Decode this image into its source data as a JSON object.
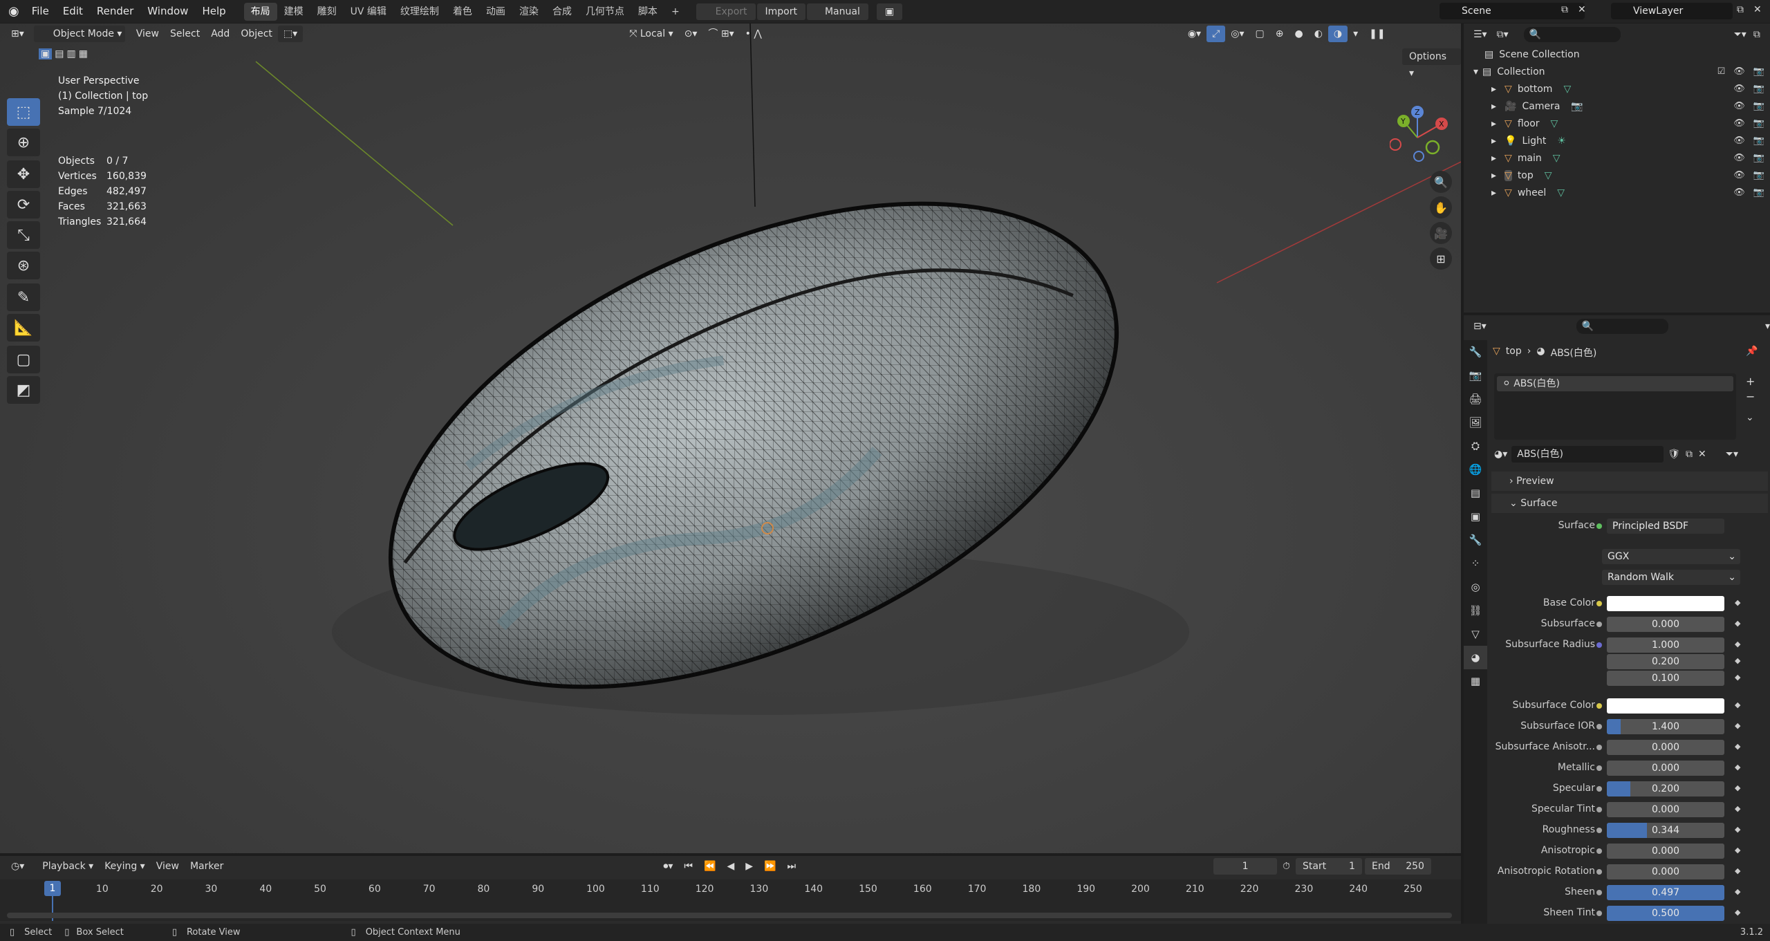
{
  "topbar": {
    "menus": [
      "File",
      "Edit",
      "Render",
      "Window",
      "Help"
    ],
    "workspaces": [
      "布局",
      "建模",
      "雕刻",
      "UV 编辑",
      "纹理绘制",
      "着色",
      "动画",
      "渲染",
      "合成",
      "几何节点",
      "脚本"
    ],
    "active_workspace": "布局",
    "add_tab": "+",
    "export": "Export",
    "import": "Import",
    "manual": "Manual",
    "scene": "Scene",
    "view_layer": "ViewLayer"
  },
  "viewport": {
    "mode": "Object Mode",
    "menus": [
      "View",
      "Select",
      "Add",
      "Object"
    ],
    "orientation": "Local",
    "options": "Options",
    "info": {
      "perspective": "User Perspective",
      "collection": "(1) Collection | top",
      "sample": "Sample 7/1024"
    },
    "stats": [
      {
        "k": "Objects",
        "v": "0 / 7"
      },
      {
        "k": "Vertices",
        "v": "160,839"
      },
      {
        "k": "Edges",
        "v": "482,497"
      },
      {
        "k": "Faces",
        "v": "321,663"
      },
      {
        "k": "Triangles",
        "v": "321,664"
      }
    ],
    "gizmo": {
      "x": "X",
      "y": "Y",
      "z": "Z"
    }
  },
  "timeline": {
    "menus": [
      "Playback",
      "Keying",
      "View",
      "Marker"
    ],
    "current_frame": "1",
    "start_label": "Start",
    "start": "1",
    "end_label": "End",
    "end": "250",
    "ticks": [
      "1",
      "10",
      "20",
      "30",
      "40",
      "50",
      "60",
      "70",
      "80",
      "90",
      "100",
      "110",
      "120",
      "130",
      "140",
      "150",
      "160",
      "170",
      "180",
      "190",
      "200",
      "210",
      "220",
      "230",
      "240",
      "250"
    ]
  },
  "statusbar": {
    "select": "Select",
    "box_select": "Box Select",
    "rotate": "Rotate View",
    "context": "Object Context Menu",
    "version": "3.1.2"
  },
  "outliner": {
    "scene_collection": "Scene Collection",
    "collection": "Collection",
    "items": [
      {
        "name": "bottom",
        "icon": "mesh-icon"
      },
      {
        "name": "Camera",
        "icon": "camera-icon"
      },
      {
        "name": "floor",
        "icon": "mesh-icon"
      },
      {
        "name": "Light",
        "icon": "light-icon"
      },
      {
        "name": "main",
        "icon": "mesh-icon"
      },
      {
        "name": "top",
        "icon": "mesh-icon"
      },
      {
        "name": "wheel",
        "icon": "mesh-icon"
      }
    ]
  },
  "properties": {
    "breadcrumb_object": "top",
    "breadcrumb_material": "ABS(白色)",
    "slot": "ABS(白色)",
    "material_name": "ABS(白色)",
    "panels": {
      "preview": "Preview",
      "surface": "Surface"
    },
    "surface_label": "Surface",
    "surface_value": "Principled BSDF",
    "distribution": "GGX",
    "subsurface_method": "Random Walk",
    "rows": [
      {
        "label": "Base Color",
        "value": "",
        "type": "color"
      },
      {
        "label": "Subsurface",
        "value": "0.000",
        "fill": 0
      },
      {
        "label": "Subsurface Radius",
        "value": "1.000",
        "fill": 0
      },
      {
        "label": "",
        "value": "0.200",
        "fill": 0
      },
      {
        "label": "",
        "value": "0.100",
        "fill": 0
      },
      {
        "label": "Subsurface Color",
        "value": "",
        "type": "color"
      },
      {
        "label": "Subsurface IOR",
        "value": "1.400",
        "fill": 0.12
      },
      {
        "label": "Subsurface Anisotr...",
        "value": "0.000",
        "fill": 0
      },
      {
        "label": "Metallic",
        "value": "0.000",
        "fill": 0
      },
      {
        "label": "Specular",
        "value": "0.200",
        "fill": 0.2
      },
      {
        "label": "Specular Tint",
        "value": "0.000",
        "fill": 0
      },
      {
        "label": "Roughness",
        "value": "0.344",
        "fill": 0.344
      },
      {
        "label": "Anisotropic",
        "value": "0.000",
        "fill": 0
      },
      {
        "label": "Anisotropic Rotation",
        "value": "0.000",
        "fill": 0
      },
      {
        "label": "Sheen",
        "value": "0.497",
        "fill": 1
      },
      {
        "label": "Sheen Tint",
        "value": "0.500",
        "fill": 1
      }
    ],
    "colors": {
      "accent": "#4772b3",
      "base_color": "#ffffff"
    }
  }
}
